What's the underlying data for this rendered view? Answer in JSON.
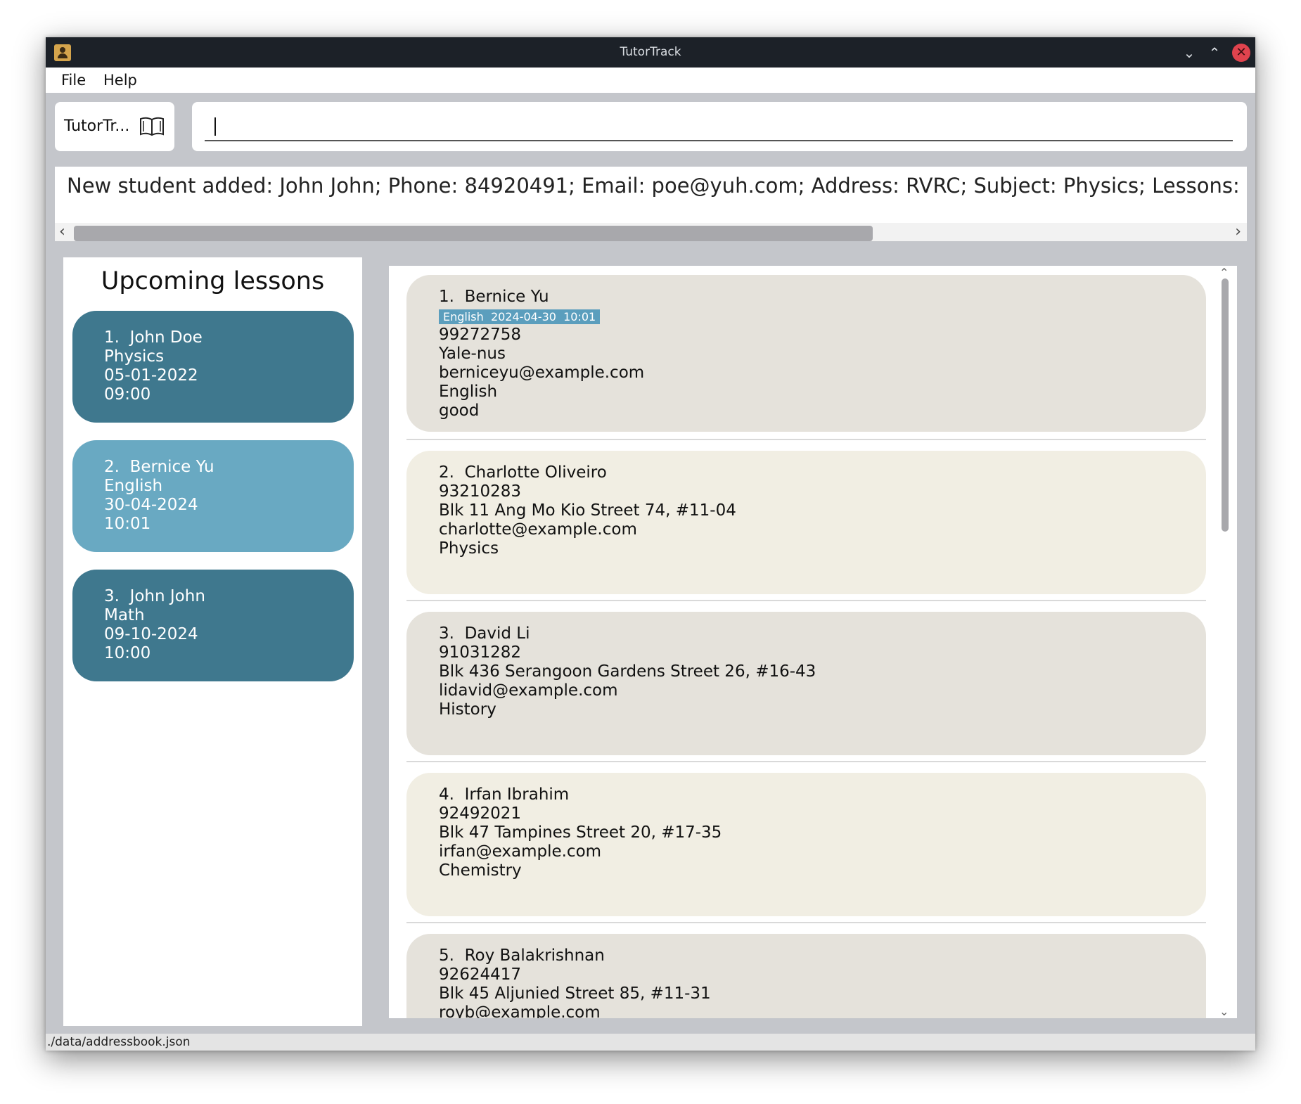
{
  "window": {
    "title": "TutorTrack",
    "buttons": {
      "minimize": "chevron-down-icon",
      "maximize": "chevron-up-icon",
      "close": "close-icon"
    }
  },
  "menu": {
    "file": "File",
    "help": "Help"
  },
  "logo": {
    "label": "TutorTr...",
    "icon": "book-icon"
  },
  "command": {
    "value": ""
  },
  "result": {
    "text": "New student added: John John; Phone: 84920491; Email: poe@yuh.com; Address: RVRC; Subject: Physics; Lessons: N"
  },
  "lessons": {
    "title": "Upcoming lessons",
    "items": [
      {
        "index": "1.",
        "name": "John Doe",
        "subject": "Physics",
        "date": "05-01-2022",
        "time": "09:00",
        "color": "#3f788e"
      },
      {
        "index": "2.",
        "name": "Bernice Yu",
        "subject": "English",
        "date": "30-04-2024",
        "time": "10:01",
        "color": "#69a9c2"
      },
      {
        "index": "3.",
        "name": "John John",
        "subject": "Math",
        "date": "09-10-2024",
        "time": "10:00",
        "color": "#3f788e"
      }
    ]
  },
  "students": [
    {
      "index": "1.",
      "name": "Bernice Yu",
      "tag": "English  2024-04-30  10:01",
      "phone": "99272758",
      "address": "Yale-nus",
      "email": "berniceyu@example.com",
      "subject": "English",
      "note": "good",
      "color": "#e5e2db"
    },
    {
      "index": "2.",
      "name": "Charlotte Oliveiro",
      "phone": "93210283",
      "address": "Blk 11 Ang Mo Kio Street 74, #11-04",
      "email": "charlotte@example.com",
      "subject": "Physics",
      "color": "#f1eee3"
    },
    {
      "index": "3.",
      "name": "David Li",
      "phone": "91031282",
      "address": "Blk 436 Serangoon Gardens Street 26, #16-43",
      "email": "lidavid@example.com",
      "subject": "History",
      "color": "#e5e2db"
    },
    {
      "index": "4.",
      "name": "Irfan Ibrahim",
      "phone": "92492021",
      "address": "Blk 47 Tampines Street 20, #17-35",
      "email": "irfan@example.com",
      "subject": "Chemistry",
      "color": "#f1eee3"
    },
    {
      "index": "5.",
      "name": "Roy Balakrishnan",
      "phone": "92624417",
      "address": "Blk 45 Aljunied Street 85, #11-31",
      "email": "royb@example.com",
      "color": "#e5e2db"
    }
  ],
  "status": {
    "path": "./data/addressbook.json"
  }
}
